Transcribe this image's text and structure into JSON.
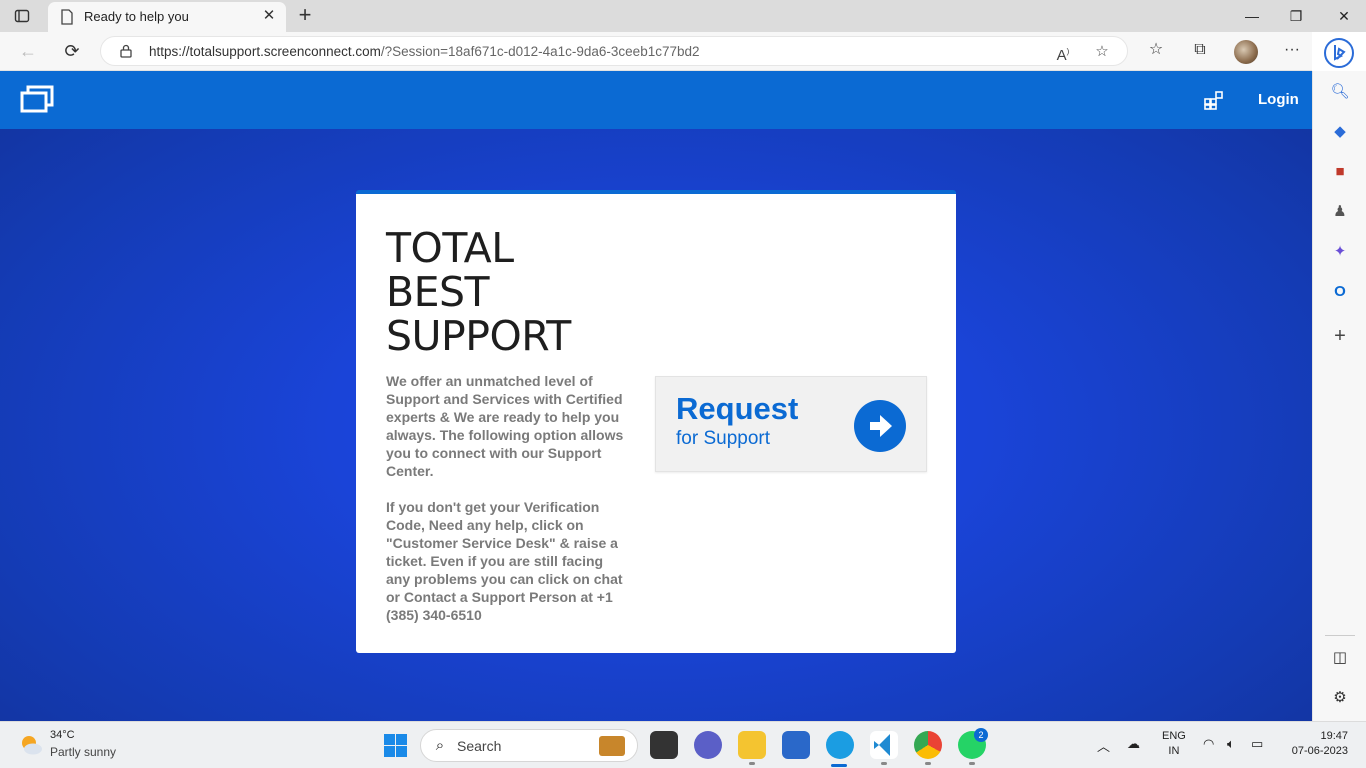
{
  "browser": {
    "tab_title": "Ready to help you",
    "new_tab_symbol": "+",
    "url_main": "https://totalsupport.screenconnect.com",
    "url_rest": "/?Session=18af671c-d012-4a1c-9da6-3ceeb1c77bd2",
    "window_controls": [
      "—",
      "❐",
      "✕"
    ]
  },
  "page": {
    "login_label": "Login",
    "headline": [
      "TOTAL",
      "BEST",
      "SUPPORT"
    ],
    "paragraph1": "We offer an unmatched level of Support and Services with Certified experts & We are ready to help you always. The following option allows you to connect with our Support Center.",
    "paragraph2": "If you don't get your Verification Code, Need any help, click on \"Customer Service Desk\" & raise a ticket. Even if you are still facing any problems you can click on chat or Contact a Support Person at +1 (385) 340-6510",
    "request_title": "Request",
    "request_subtitle": "for Support",
    "accent_color": "#0b6ad3"
  },
  "taskbar": {
    "temperature": "34°C",
    "condition": "Partly sunny",
    "search_label": "Search",
    "whatsapp_badge": "2",
    "language_line1": "ENG",
    "language_line2": "IN",
    "time": "19:47",
    "date": "07-06-2023"
  }
}
